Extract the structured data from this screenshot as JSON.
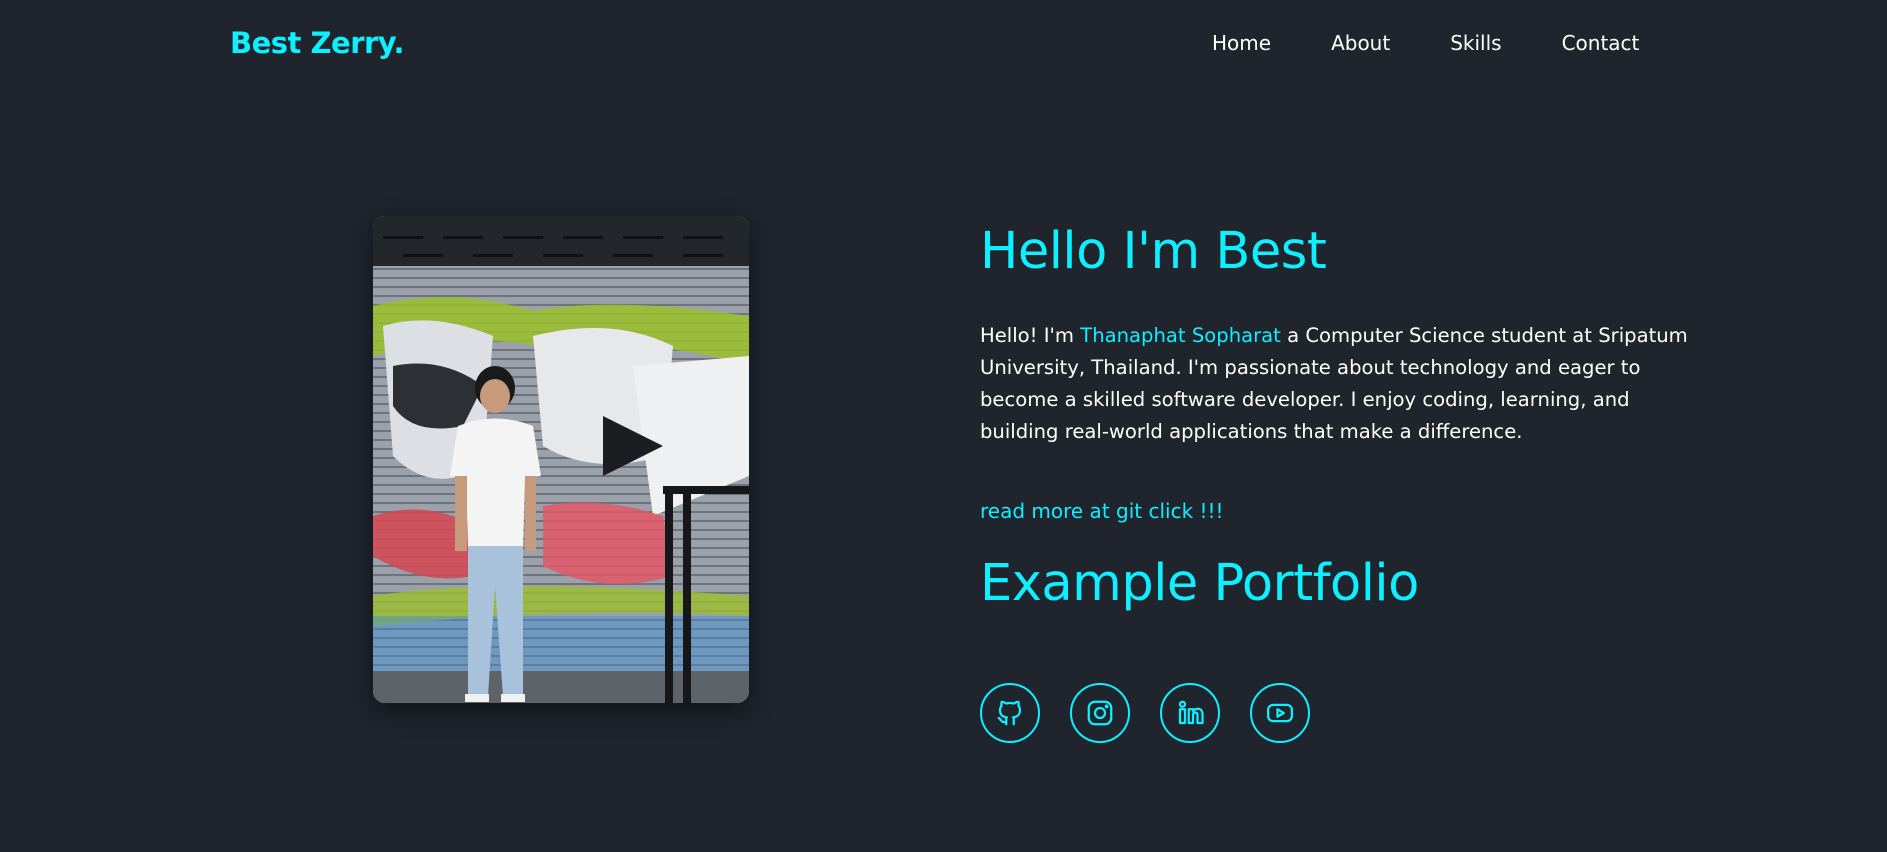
{
  "header": {
    "logo": "Best Zerry.",
    "nav": [
      "Home",
      "About",
      "Skills",
      "Contact"
    ]
  },
  "hero": {
    "heading": "Hello I'm Best",
    "bio_prefix": "Hello! I'm ",
    "bio_name": "Thanaphat Sopharat",
    "bio_suffix": " a Computer Science student at Sripatum University, Thailand. I'm passionate about technology and eager to become a skilled software developer. I enjoy coding, learning, and building real-world applications that make a difference.",
    "read_more": "read more at git click !!!",
    "portfolio_heading": "Example Portfolio"
  },
  "socials": [
    {
      "icon": "github-icon"
    },
    {
      "icon": "instagram-icon"
    },
    {
      "icon": "linkedin-icon"
    },
    {
      "icon": "youtube-icon"
    }
  ],
  "colors": {
    "background": "#1f242d",
    "accent": "#0ef0ff",
    "text": "#ffffff"
  }
}
